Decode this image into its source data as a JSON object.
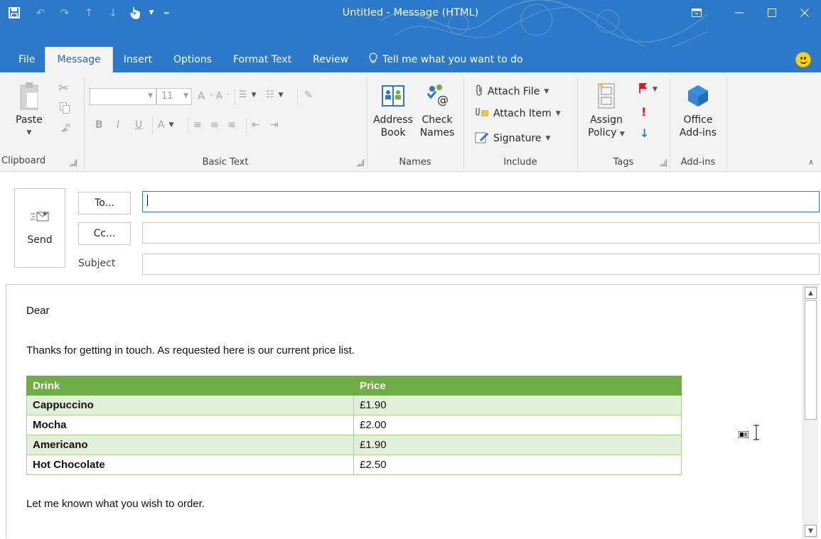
{
  "window": {
    "title": "Untitled - Message (HTML)"
  },
  "tabs": [
    {
      "label": "File"
    },
    {
      "label": "Message"
    },
    {
      "label": "Insert"
    },
    {
      "label": "Options"
    },
    {
      "label": "Format Text"
    },
    {
      "label": "Review"
    }
  ],
  "tell_me": "Tell me what you want to do",
  "ribbon": {
    "clipboard": {
      "label": "Clipboard",
      "paste": "Paste"
    },
    "basic_text": {
      "label": "Basic Text",
      "font_size": "11",
      "bold": "B",
      "italic": "I",
      "underline": "U",
      "font_color": "A"
    },
    "names": {
      "label": "Names",
      "address_book_line1": "Address",
      "address_book_line2": "Book",
      "check_names_line1": "Check",
      "check_names_line2": "Names"
    },
    "include": {
      "label": "Include",
      "attach_file": "Attach File",
      "attach_item": "Attach Item",
      "signature": "Signature"
    },
    "tags": {
      "label": "Tags",
      "assign_policy_line1": "Assign",
      "assign_policy_line2": "Policy",
      "high_importance": "!"
    },
    "addins": {
      "label": "Add-ins",
      "office_addins_line1": "Office",
      "office_addins_line2": "Add-ins"
    }
  },
  "compose": {
    "send": "Send",
    "to_button": "To...",
    "cc_button": "Cc...",
    "subject_label": "Subject",
    "to_value": "",
    "cc_value": "",
    "subject_value": ""
  },
  "body": {
    "greeting": "Dear",
    "intro": "Thanks for getting in touch. As requested here is our current price list.",
    "table": {
      "headers": [
        "Drink",
        "Price"
      ],
      "rows": [
        [
          "Cappuccino",
          "£1.90"
        ],
        [
          "Mocha",
          "£2.00"
        ],
        [
          "Americano",
          "£1.90"
        ],
        [
          "Hot Chocolate",
          "£2.50"
        ]
      ]
    },
    "closing": "Let me known what you wish to order."
  },
  "colors": {
    "title_bar": "#2b79c8",
    "table_header": "#70ad47",
    "table_band": "#e2efda",
    "table_border": "#a9d08e"
  }
}
